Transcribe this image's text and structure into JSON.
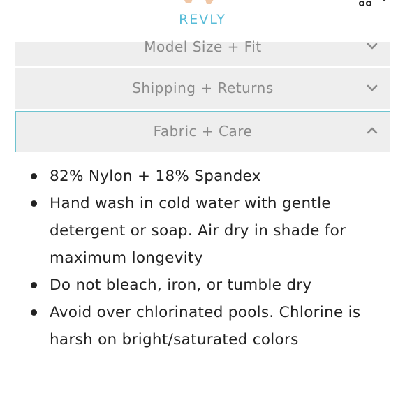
{
  "header": {
    "brand": "REVLY",
    "cart_count": "0",
    "icons": [
      "menu-icon",
      "logo-mark",
      "cart-icon"
    ],
    "colors": {
      "brand": "#58bcd8",
      "logo_mark": "#f0c7a6"
    }
  },
  "accordion": [
    {
      "label": "Model Size + Fit",
      "state": "collapsed",
      "icon": "chevron-down-icon"
    },
    {
      "label": "Shipping + Returns",
      "state": "collapsed",
      "icon": "chevron-down-icon"
    },
    {
      "label": "Fabric + Care",
      "state": "expanded",
      "icon": "chevron-up-icon"
    }
  ],
  "fabric_care": {
    "items": [
      "82% Nylon + 18% Spandex",
      "Hand wash in cold water with gentle detergent or soap. Air dry in shade for maximum longevity",
      "Do not bleach, iron, or tumble dry",
      "Avoid over chlorinated pools. Chlorine is harsh on bright/saturated colors"
    ]
  },
  "colors": {
    "panel_bg": "#eeeeee",
    "active_border": "#6ec3cf",
    "label_text": "#8a8a8a",
    "body_text": "#222222"
  }
}
